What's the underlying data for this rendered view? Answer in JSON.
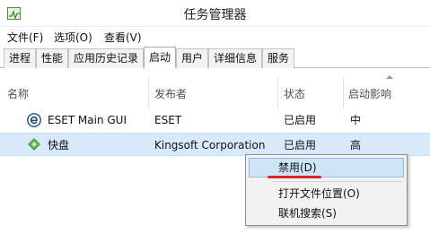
{
  "window": {
    "title": "任务管理器"
  },
  "menu": [
    "文件(F)",
    "选项(O)",
    "查看(V)"
  ],
  "tabs": [
    "进程",
    "性能",
    "应用历史记录",
    "启动",
    "用户",
    "详细信息",
    "服务"
  ],
  "active_tab": "启动",
  "columns": {
    "name": "名称",
    "publisher": "发布者",
    "status": "状态",
    "impact": "启动影响"
  },
  "rows": [
    {
      "icon": "eset-icon",
      "name": "ESET Main GUI",
      "publisher": "ESET",
      "status": "已启用",
      "impact": "中"
    },
    {
      "icon": "kuaipan-icon",
      "name": "快盘",
      "publisher": "Kingsoft Corporation",
      "status": "已启用",
      "impact": "高",
      "selected": true
    }
  ],
  "context_menu": {
    "items": [
      "禁用(D)",
      "打开文件位置(O)",
      "联机搜索(S)"
    ],
    "hovered": "禁用(D)"
  },
  "colors": {
    "selection": "#d9e9fb",
    "menu_hover": "#cde4f9",
    "annotation": "#d7262b",
    "eset_blue": "#1f4e8c",
    "kuaipan_green": "#4aa54a"
  }
}
